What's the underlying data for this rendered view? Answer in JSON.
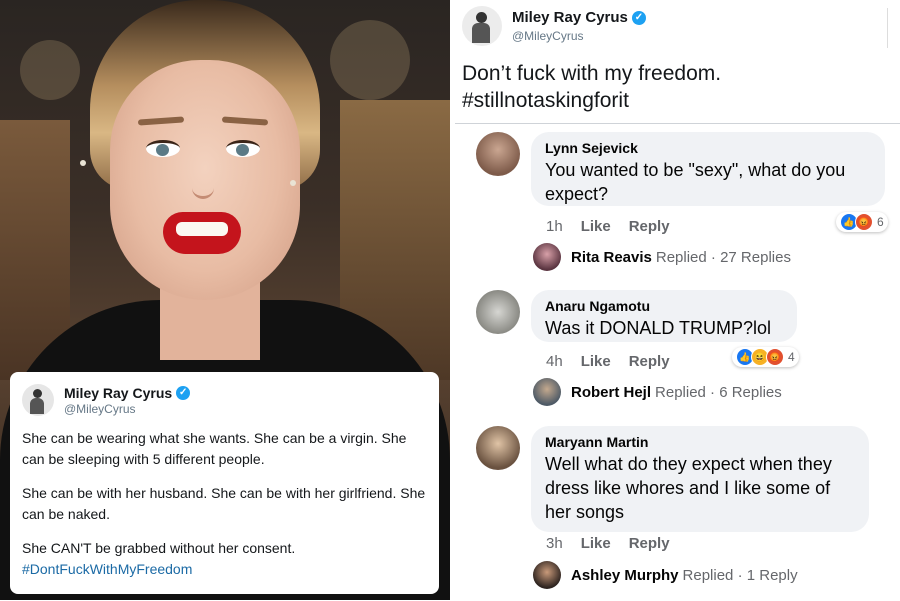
{
  "photo_tweet": {
    "name": "Miley Ray Cyrus",
    "handle": "@MileyCyrus",
    "lines": [
      "She can be wearing what she wants. She can be a virgin. She can be sleeping with 5 different people.",
      "She can be with her husband. She can be with her girlfriend. She can be naked.",
      "She CAN'T be grabbed without her consent."
    ],
    "hashtag": "#DontFuckWithMyFreedom"
  },
  "main_tweet": {
    "name": "Miley Ray Cyrus",
    "handle": "@MileyCyrus",
    "text_line1": "Don’t fuck with my freedom.",
    "text_line2": "#stillnotaskingforit"
  },
  "comments": [
    {
      "author": "Lynn Sejevick",
      "text": "You wanted to be \"sexy\", what do you expect?",
      "time": "1h",
      "like": "Like",
      "reply": "Reply",
      "reaction_count": "6",
      "reply_author": "Rita Reavis",
      "reply_summary": "Replied · 27 Replies"
    },
    {
      "author": "Anaru Ngamotu",
      "text": "Was it DONALD TRUMP?lol",
      "time": "4h",
      "like": "Like",
      "reply": "Reply",
      "reaction_count": "4",
      "reply_author": "Robert Hejl",
      "reply_summary": "Replied · 6 Replies"
    },
    {
      "author": "Maryann Martin",
      "text": "Well what do they expect when they dress like whores and I like some of her songs",
      "time": "3h",
      "like": "Like",
      "reply": "Reply",
      "reply_author": "Ashley Murphy",
      "reply_summary": "Replied · 1 Reply"
    }
  ],
  "colors": {
    "verified": "#1da1f2",
    "hashtag": "#1b6aa5",
    "fb_like": "#1877f2",
    "lips": "#c4141c"
  }
}
